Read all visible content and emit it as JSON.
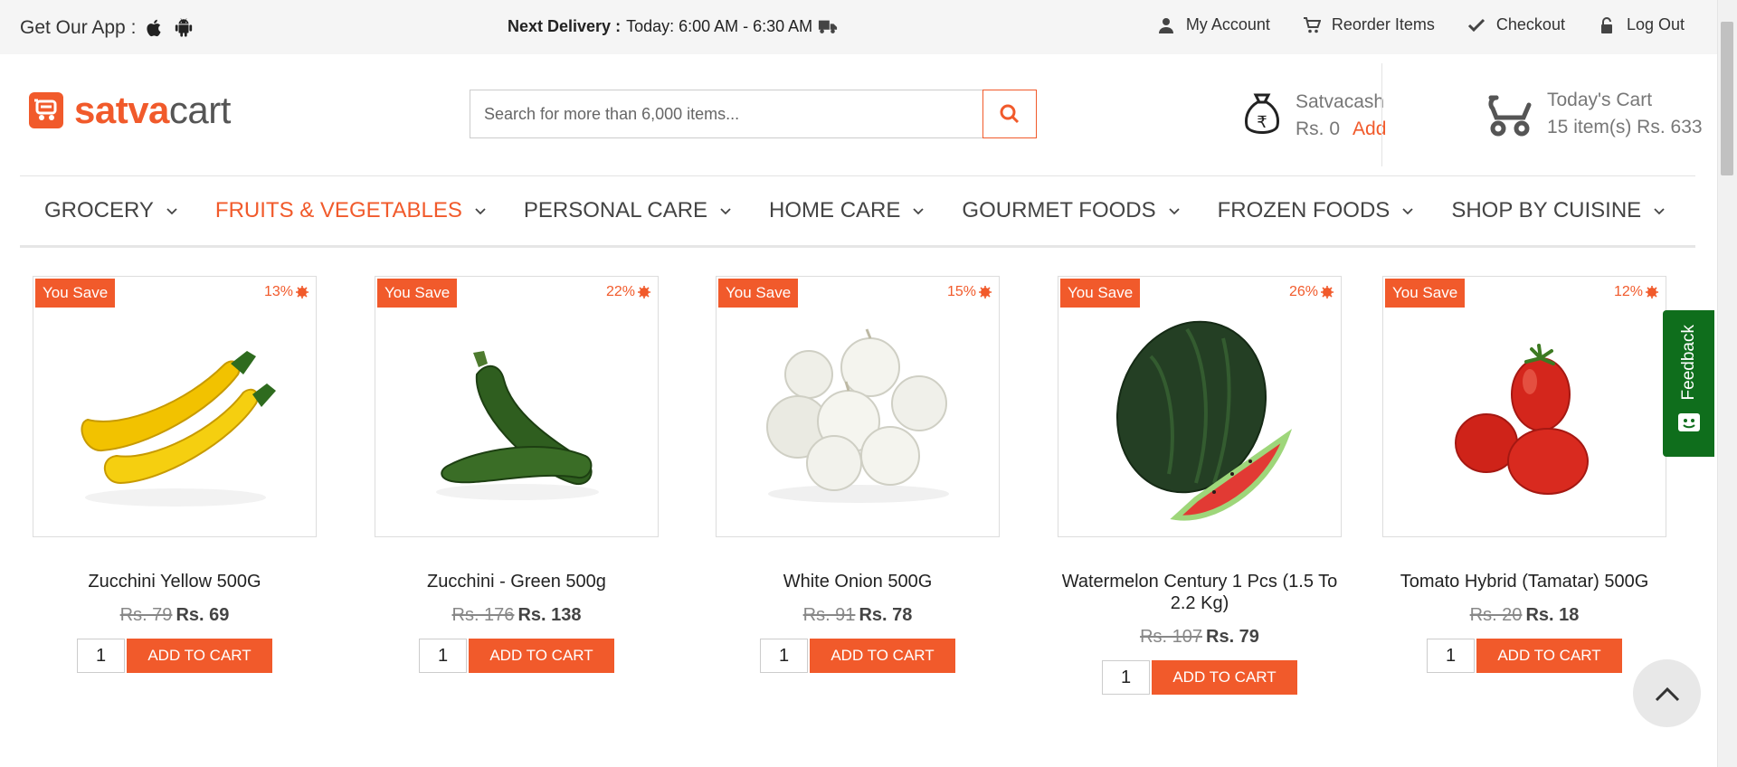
{
  "topbar": {
    "app_label": "Get Our App :",
    "delivery_label": "Next Delivery :",
    "delivery_value": "Today: 6:00 AM - 6:30 AM",
    "links": [
      {
        "label": "My Account",
        "icon": "user-icon"
      },
      {
        "label": "Reorder Items",
        "icon": "cart-icon"
      },
      {
        "label": "Checkout",
        "icon": "check-icon"
      },
      {
        "label": "Log Out",
        "icon": "lock-icon"
      }
    ]
  },
  "header": {
    "logo_part1": "satva",
    "logo_part2": "cart",
    "search_placeholder": "Search for more than 6,000 items...",
    "satvacash_label": "Satvacash",
    "satvacash_amount": "Rs. 0",
    "satvacash_add": "Add",
    "cart_label": "Today's Cart",
    "cart_summary": "15 item(s) Rs. 633"
  },
  "nav": {
    "items": [
      {
        "label": "GROCERY",
        "active": false
      },
      {
        "label": "FRUITS & VEGETABLES",
        "active": true
      },
      {
        "label": "PERSONAL CARE",
        "active": false
      },
      {
        "label": "HOME CARE",
        "active": false
      },
      {
        "label": "GOURMET FOODS",
        "active": false
      },
      {
        "label": "FROZEN FOODS",
        "active": false
      },
      {
        "label": "SHOP BY CUISINE",
        "active": false
      }
    ]
  },
  "products": [
    {
      "save_label": "You Save",
      "discount": "13%",
      "name": "Zucchini Yellow 500G",
      "old_price": "Rs. 79",
      "new_price": "Rs. 69",
      "qty": "1",
      "button": "ADD TO CART",
      "image": "yellow-zucchini"
    },
    {
      "save_label": "You Save",
      "discount": "22%",
      "name": "Zucchini - Green 500g",
      "old_price": "Rs. 176",
      "new_price": "Rs. 138",
      "qty": "1",
      "button": "ADD TO CART",
      "image": "green-zucchini"
    },
    {
      "save_label": "You Save",
      "discount": "15%",
      "name": "White Onion 500G",
      "old_price": "Rs. 91",
      "new_price": "Rs. 78",
      "qty": "1",
      "button": "ADD TO CART",
      "image": "white-onion"
    },
    {
      "save_label": "You Save",
      "discount": "26%",
      "name": "Watermelon Century 1 Pcs (1.5 To 2.2 Kg)",
      "old_price": "Rs. 107",
      "new_price": "Rs. 79",
      "qty": "1",
      "button": "ADD TO CART",
      "image": "watermelon"
    },
    {
      "save_label": "You Save",
      "discount": "12%",
      "name": "Tomato Hybrid (Tamatar) 500G",
      "old_price": "Rs. 20",
      "new_price": "Rs. 18",
      "qty": "1",
      "button": "ADD TO CART",
      "image": "tomato"
    }
  ],
  "feedback_label": "Feedback",
  "colors": {
    "accent": "#f15a2b",
    "feedback_green": "#0f6e1c"
  }
}
